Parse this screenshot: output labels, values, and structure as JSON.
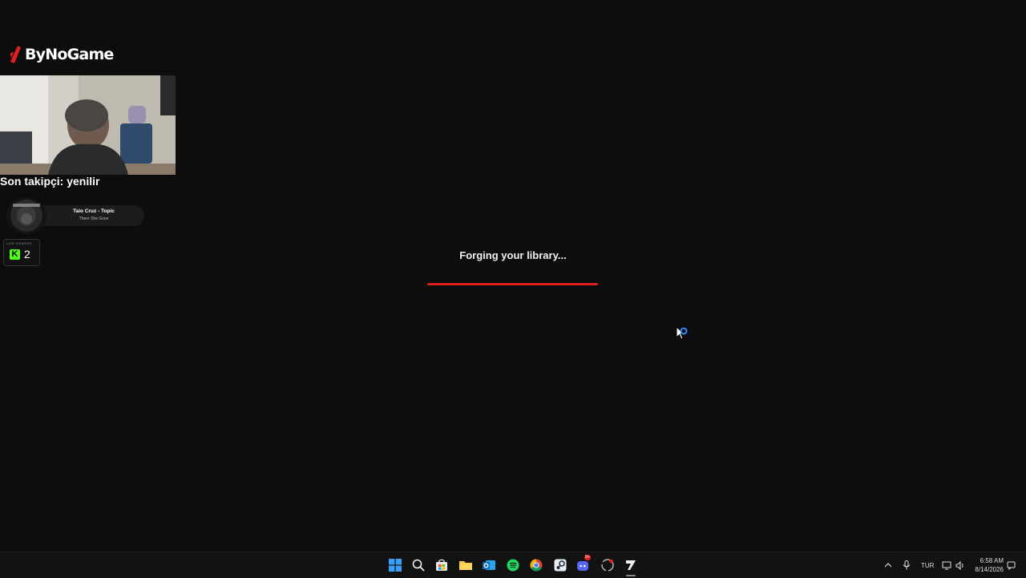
{
  "overlay": {
    "logo_text": "ByNoGame",
    "last_follower": "Son takipçi: yenilir",
    "now_playing": {
      "artist": "Taio Cruz - Topic",
      "song": "There She Goes"
    },
    "viewers": {
      "label": "LIVE VIEWERS",
      "platform_letter": "K",
      "count": "2"
    }
  },
  "loader": {
    "message": "Forging your library...",
    "progress": 1.0,
    "accent_color": "#e0201f"
  },
  "taskbar": {
    "icons": [
      "windows-start-icon",
      "search-icon",
      "microsoft-store-icon",
      "file-explorer-icon",
      "outlook-icon",
      "spotify-icon",
      "chrome-icon",
      "steam-icon",
      "discord-icon",
      "obs-icon",
      "app-x-icon"
    ],
    "discord_badge": "9+",
    "language": "TUR",
    "time": "6:58 AM",
    "date": "8/14/2026"
  }
}
